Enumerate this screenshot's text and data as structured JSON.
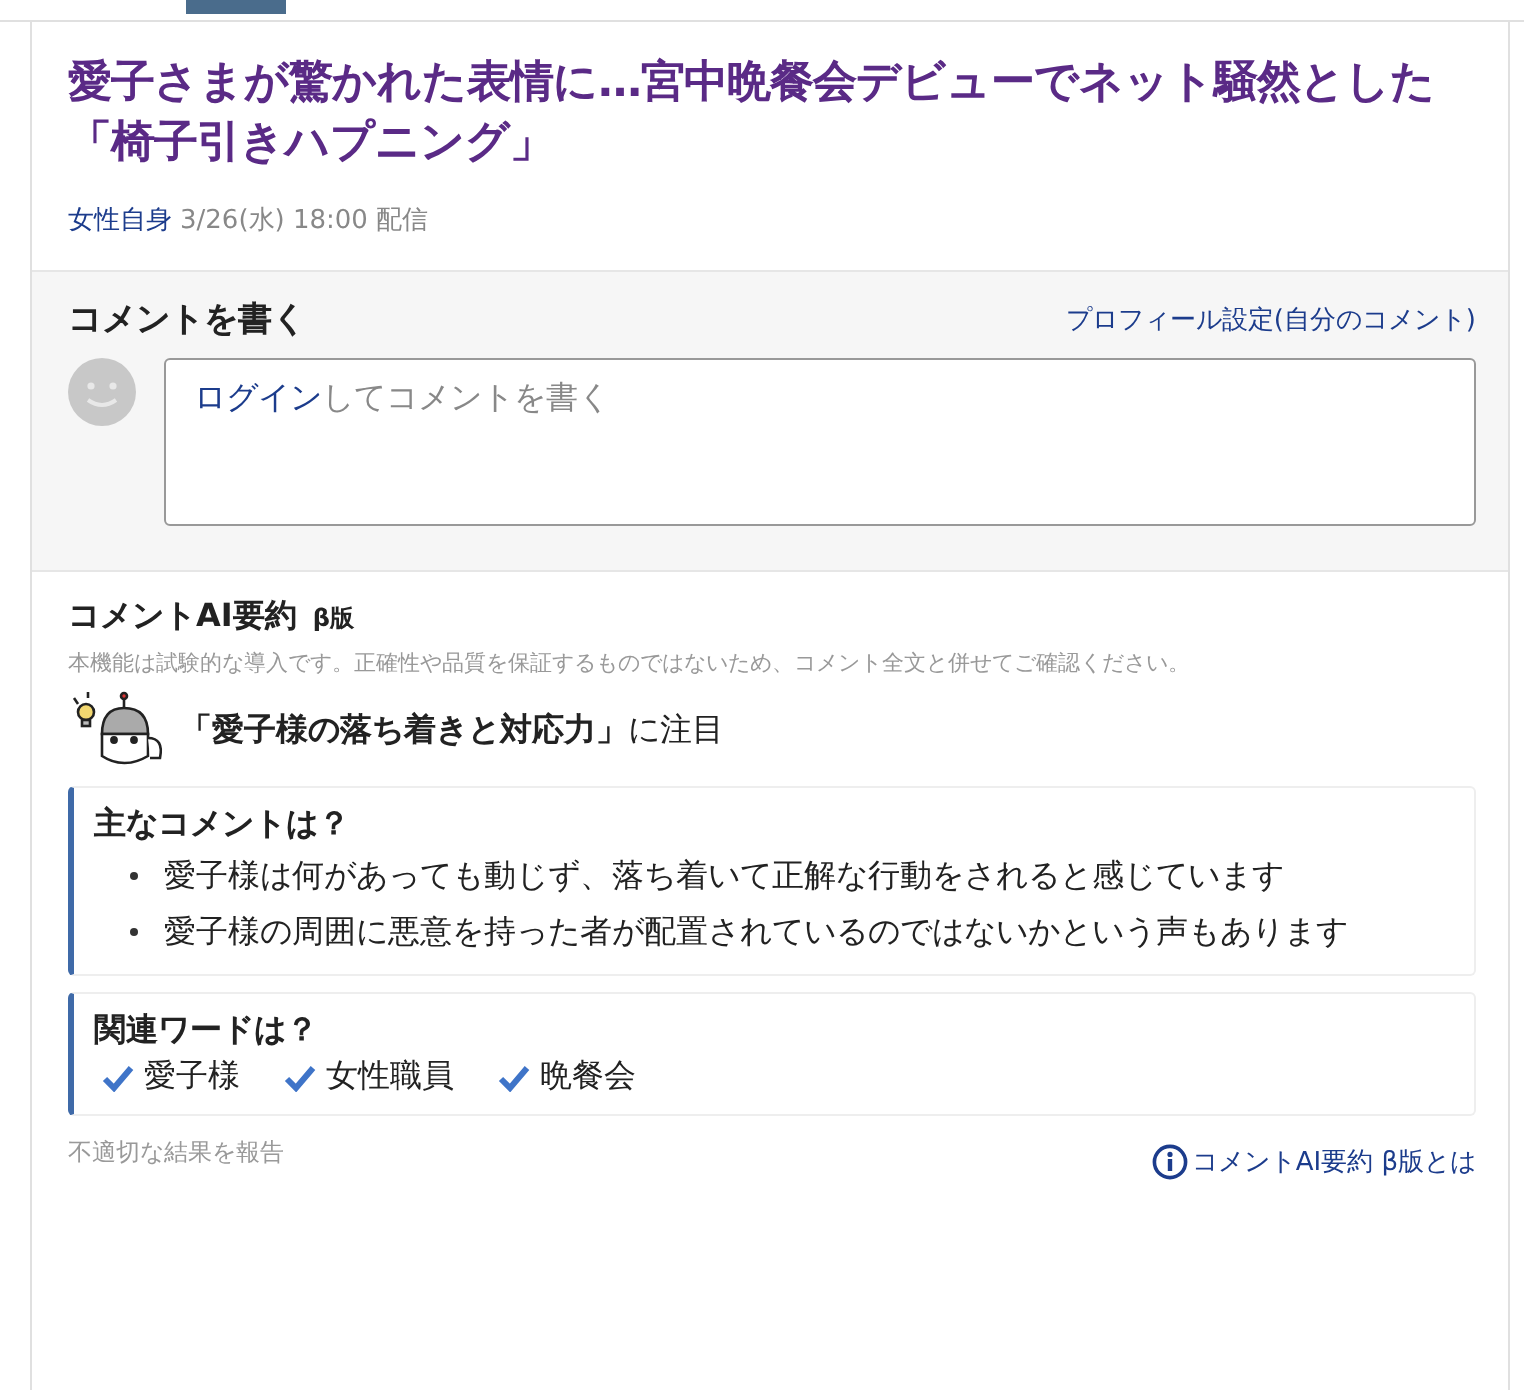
{
  "article": {
    "title": "愛子さまが驚かれた表情に…宮中晩餐会デビューでネット騒然とした「椅子引きハプニング」",
    "source": "女性自身",
    "date": "3/26(水) 18:00 配信"
  },
  "comment_form": {
    "heading": "コメントを書く",
    "profile_link": "プロフィール設定(自分のコメント)",
    "login_link": "ログイン",
    "placeholder": "してコメントを書く"
  },
  "ai_summary": {
    "heading": "コメントAI要約",
    "badge": "β版",
    "disclaimer": "本機能は試験的な導入です。正確性や品質を保証するものではないため、コメント全文と併せてご確認ください。",
    "focus": "「愛子様の落ち着きと対応力」",
    "focus_suffix": "に注目",
    "main_heading": "主なコメントは？",
    "main_comments": [
      "愛子様は何があっても動じず、落ち着いて正解な行動をされると感じています",
      "愛子様の周囲に悪意を持った者が配置されているのではないかという声もあります"
    ],
    "keywords_heading": "関連ワードは？",
    "keywords": [
      "愛子様",
      "女性職員",
      "晩餐会"
    ],
    "report_link": "不適切な結果を報告",
    "about_link": "コメントAI要約 β版とは"
  }
}
